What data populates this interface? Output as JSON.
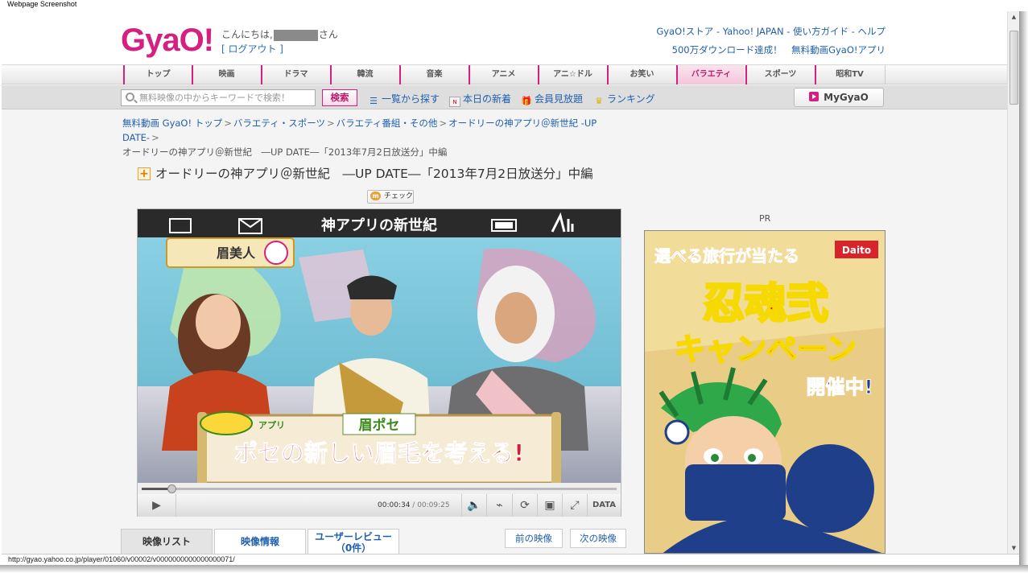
{
  "caption": "Webpage Screenshot",
  "header": {
    "logo": "GyaO!",
    "greeting_prefix": "こんにちは,",
    "greeting_suffix": "さん",
    "logout": "[ ログアウト ]",
    "top_links": "GyaO!ストア - Yahoo! JAPAN - 使い方ガイド - ヘルプ",
    "promo_links": "500万ダウンロード達成！　無料動画GyaO!アプリ"
  },
  "nav": [
    "トップ",
    "映画",
    "ドラマ",
    "韓流",
    "音楽",
    "アニメ",
    "アニ☆ドル",
    "お笑い",
    "バラエティ",
    "スポーツ",
    "昭和TV"
  ],
  "nav_active": "バラエティ",
  "toolbar": {
    "search_placeholder": "無料映像の中からキーワードで検索！",
    "search_button": "検索",
    "links": [
      "一覧から探す",
      "本日の新着",
      "会員見放題",
      "ランキング"
    ],
    "mygyao": "MyGyaO"
  },
  "breadcrumb": {
    "items": [
      "無料動画 GyaO! トップ",
      "バラエティ・スポーツ",
      "バラエティ番組・その他",
      "オードリーの神アプリ＠新世紀 -UP DATE-"
    ],
    "current": "オードリーの神アプリ＠新世紀　―UP DATE―「2013年7月2日放送分」中編"
  },
  "page_title": "オードリーの神アプリ＠新世紀　―UP DATE―「2013年7月2日放送分」中編",
  "check_button": "チェック",
  "video": {
    "top_banner": "神アプリの新世紀",
    "corner_label": "眉美人",
    "scroll_heading": "眉ポセ",
    "scroll_caption": "ポセの新しい眉毛を考える!",
    "scroll_tag": "アプリ"
  },
  "player": {
    "progress": 0.065,
    "current_time": "00:00:34",
    "total_time": "/ 00:09:25",
    "data_label": "DATA"
  },
  "tabs": [
    "映像リスト",
    "映像情報",
    "ユーザーレビュー（0件）"
  ],
  "prev_button": "前の映像",
  "next_button": "次の映像",
  "ad": {
    "pr_label": "PR",
    "headline": "選べる旅行が当たる",
    "brand": "Daito",
    "campaign_title": "忍魂弐",
    "campaign_sub": "キャンペーン",
    "status": "開催中!"
  },
  "status_url": "http://gyao.yahoo.co.jp/player/01060/v00002/v0000000000000000071/"
}
